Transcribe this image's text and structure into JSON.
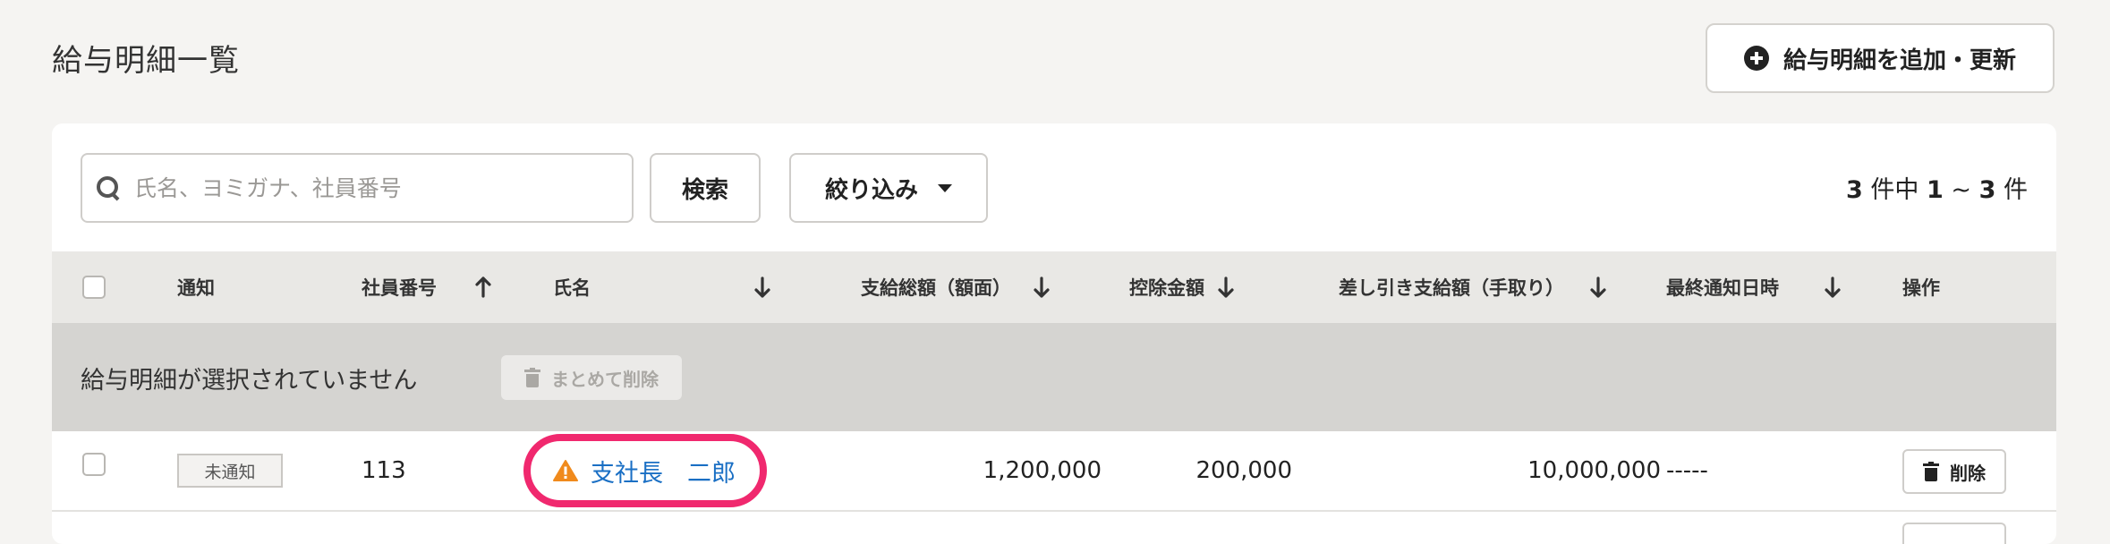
{
  "page": {
    "title": "給与明細一覧"
  },
  "header": {
    "add_button_label": "給与明細を追加・更新"
  },
  "search": {
    "placeholder": "氏名、ヨミガナ、社員番号",
    "value": "",
    "button_label": "検索"
  },
  "filter": {
    "label": "絞り込み"
  },
  "pagination": {
    "total": "3",
    "unit_a": "件中",
    "range_start": "1",
    "tilde": "~",
    "range_end": "3",
    "unit_b": "件"
  },
  "table": {
    "columns": [
      {
        "key": "notify",
        "label": "通知",
        "sort": ""
      },
      {
        "key": "employee_no",
        "label": "社員番号",
        "sort": "up"
      },
      {
        "key": "name",
        "label": "氏名",
        "sort": "down"
      },
      {
        "key": "gross",
        "label": "支給総額（額面）",
        "sort": "down"
      },
      {
        "key": "deduction",
        "label": "控除金額",
        "sort": "down"
      },
      {
        "key": "net",
        "label": "差し引き支給額（手取り）",
        "sort": "down"
      },
      {
        "key": "last_notified",
        "label": "最終通知日時",
        "sort": "down"
      },
      {
        "key": "actions",
        "label": "操作",
        "sort": ""
      }
    ],
    "bulk": {
      "none_selected_text": "給与明細が選択されていません",
      "bulk_delete_label": "まとめて削除"
    },
    "rows": [
      {
        "status": "未通知",
        "employee_no": "113",
        "name": "支社長　二郎",
        "name_warning": true,
        "gross": "1,200,000",
        "deduction": "200,000",
        "net": "10,000,000",
        "last_notified": "-----",
        "delete_label": "削除"
      }
    ]
  },
  "colors": {
    "highlight": "#f0286e",
    "link": "#1a6fc4",
    "warning": "#f08a1c"
  }
}
